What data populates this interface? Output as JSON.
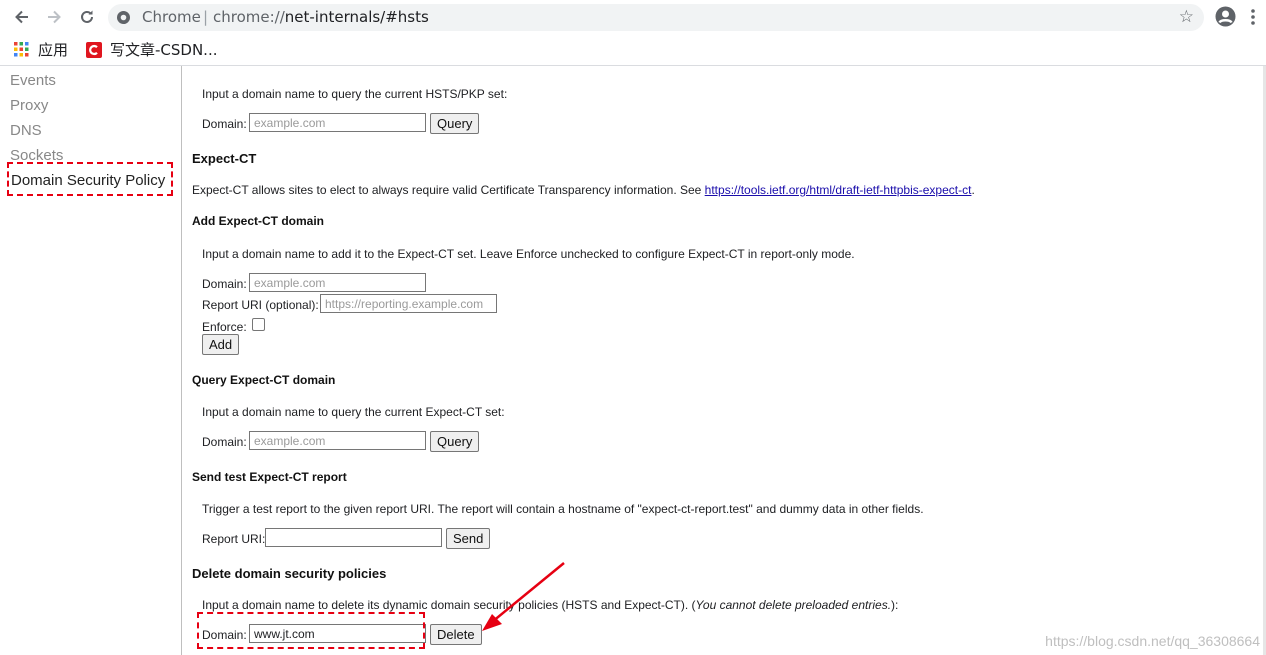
{
  "browser": {
    "host_label": "Chrome",
    "separator": "|",
    "url_prefix": "chrome://",
    "url_rest": "net-internals/#hsts",
    "bookmarks": [
      {
        "label": "应用",
        "icon": "apps-grid-icon"
      },
      {
        "label": "写文章-CSDN...",
        "icon": "csdn-logo-icon"
      }
    ]
  },
  "sidebar": {
    "items": [
      {
        "label": "Events"
      },
      {
        "label": "Proxy"
      },
      {
        "label": "DNS"
      },
      {
        "label": "Sockets"
      },
      {
        "label": "Domain Security Policy"
      }
    ],
    "active_index": 4
  },
  "query_hsts": {
    "desc": "Input a domain name to query the current HSTS/PKP set:",
    "domain_label": "Domain:",
    "placeholder": "example.com",
    "button": "Query"
  },
  "expect_ct": {
    "title": "Expect-CT",
    "desc_prefix": "Expect-CT allows sites to elect to always require valid Certificate Transparency information. See ",
    "link": "https://tools.ietf.org/html/draft-ietf-httpbis-expect-ct",
    "desc_suffix": "."
  },
  "add_ct": {
    "title": "Add Expect-CT domain",
    "desc": "Input a domain name to add it to the Expect-CT set. Leave Enforce unchecked to configure Expect-CT in report-only mode.",
    "domain_label": "Domain:",
    "domain_placeholder": "example.com",
    "report_label": "Report URI (optional):",
    "report_placeholder": "https://reporting.example.com",
    "enforce_label": "Enforce:",
    "button": "Add"
  },
  "query_ct": {
    "title": "Query Expect-CT domain",
    "desc": "Input a domain name to query the current Expect-CT set:",
    "domain_label": "Domain:",
    "placeholder": "example.com",
    "button": "Query"
  },
  "send_ct": {
    "title": "Send test Expect-CT report",
    "desc": "Trigger a test report to the given report URI. The report will contain a hostname of \"expect-ct-report.test\" and dummy data in other fields.",
    "report_label": "Report URI:",
    "button": "Send"
  },
  "delete_policy": {
    "title": "Delete domain security policies",
    "desc_prefix": "Input a domain name to delete its dynamic domain security policies (HSTS and Expect-CT). (",
    "desc_italic": "You cannot delete preloaded entries.",
    "desc_suffix": "):",
    "domain_label": "Domain:",
    "domain_value": "www.jt.com",
    "button": "Delete"
  },
  "watermark": "https://blog.csdn.net/qq_36308664",
  "colors": {
    "annotation_red": "#e60012",
    "link": "#1a0dab"
  }
}
